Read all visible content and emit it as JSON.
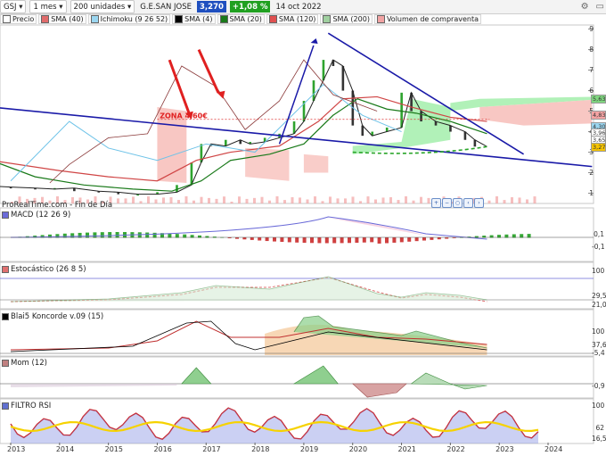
{
  "toolbar": {
    "symbol": "GSJ",
    "period": "1 mes",
    "units": "200 unidades",
    "instrument": "G.E.SAN JOSE",
    "last_price": "3,270",
    "change": "+1,08 %",
    "date": "14 oct 2022"
  },
  "legend": {
    "items": [
      {
        "label": "Precio",
        "color": "#ffffff"
      },
      {
        "label": "SMA (40)",
        "color": "#e06b6b"
      },
      {
        "label": "Ichimoku (9 26 52)",
        "color": "#9bd6f0"
      },
      {
        "label": "SMA (4)",
        "color": "#000000"
      },
      {
        "label": "SMA (20)",
        "color": "#1a7a1a"
      },
      {
        "label": "SMA (120)",
        "color": "#e05050"
      },
      {
        "label": "SMA (200)",
        "color": "#a0d0a0"
      },
      {
        "label": "Volumen de compraventa",
        "color": "#f2a3a3"
      }
    ]
  },
  "main_pane": {
    "source": "ProRealTime.com - Fin de Día",
    "annotation": "ZONA 4,60€",
    "y_ticks": [
      "9",
      "8",
      "7",
      "6",
      "5",
      "4",
      "3",
      "2",
      "1"
    ],
    "value_tags": [
      {
        "text": "5,63",
        "color": "#7fd67f",
        "value": 5.63
      },
      {
        "text": "4,83",
        "color": "#f4a3a3",
        "value": 4.83
      },
      {
        "text": "4,30",
        "color": "#9bd6f0",
        "value": 4.3
      },
      {
        "text": "3,96",
        "color": "#ffffff",
        "value": 3.96
      },
      {
        "text": "3,65",
        "color": "#ffffff",
        "value": 3.65
      },
      {
        "text": "3,27",
        "color": "#f6c400",
        "value": 3.27
      }
    ]
  },
  "panes": {
    "macd": {
      "label": "MACD (12 26 9)",
      "color": "#6a6ad8",
      "y_ticks": [
        "0,1",
        "-0,1"
      ]
    },
    "stoch": {
      "label": "Estocástico (26 8 5)",
      "color": "#e07070",
      "y_ticks": [
        "100",
        "29,5",
        "21,0"
      ]
    },
    "blai5": {
      "label": "Blai5 Koncorde v.09 (15)",
      "color": "#000000",
      "y_ticks": [
        "100",
        "37,6",
        "-5,4"
      ]
    },
    "mom": {
      "label": "Mom (12)",
      "color": "#c08080",
      "y_ticks": [
        "-0,9"
      ]
    },
    "rsi": {
      "label": "FILTRO RSI",
      "color": "#6070d0",
      "y_ticks": [
        "100",
        "62",
        "16,5"
      ]
    }
  },
  "chart_data": {
    "type": "line",
    "title": "G.E.SAN JOSE (GSJ) — 1 mes",
    "x_axis": {
      "ticks": [
        "2013",
        "2014",
        "2015",
        "2016",
        "2017",
        "2018",
        "2019",
        "2020",
        "2021",
        "2022",
        "2023",
        "2024"
      ]
    },
    "y_axis": {
      "min": 0.5,
      "max": 9.2,
      "ticks": [
        1,
        2,
        3,
        4,
        5,
        6,
        7,
        8,
        9
      ]
    },
    "series": [
      {
        "name": "Precio",
        "x": [
          2012.6,
          2013.0,
          2013.5,
          2013.9,
          2014.3,
          2014.8,
          2015.2,
          2015.6,
          2016.0,
          2016.4,
          2016.7,
          2016.9,
          2017.1,
          2017.4,
          2017.7,
          2017.9,
          2018.2,
          2018.5,
          2018.8,
          2019.0,
          2019.2,
          2019.4,
          2019.6,
          2019.8,
          2020.0,
          2020.2,
          2020.4,
          2020.7,
          2021.0,
          2021.2,
          2021.4,
          2021.7,
          2022.0,
          2022.3,
          2022.5,
          2022.75
        ],
        "values": [
          1.35,
          1.3,
          1.25,
          1.2,
          1.25,
          1.1,
          1.05,
          0.95,
          0.95,
          1.05,
          1.4,
          2.5,
          3.4,
          3.3,
          3.6,
          3.4,
          3.5,
          3.7,
          3.9,
          4.5,
          5.5,
          6.5,
          7.5,
          7.2,
          6.0,
          4.3,
          3.8,
          4.0,
          4.2,
          5.9,
          5.0,
          4.5,
          4.3,
          4.0,
          3.6,
          3.27
        ]
      },
      {
        "name": "SMA (40)",
        "x": [
          2012.6,
          2014.0,
          2015.0,
          2016.0,
          2016.8,
          2017.5,
          2018.5,
          2019.3,
          2019.8,
          2020.5,
          2021.2,
          2022.0,
          2022.75
        ],
        "values": [
          2.6,
          2.1,
          1.8,
          1.6,
          2.6,
          3.0,
          3.3,
          4.5,
          5.6,
          5.7,
          5.2,
          4.7,
          4.5
        ]
      },
      {
        "name": "SMA (20)",
        "x": [
          2012.6,
          2013.5,
          2014.5,
          2015.5,
          2016.3,
          2016.9,
          2017.5,
          2018.3,
          2019.0,
          2019.6,
          2020.1,
          2020.7,
          2021.3,
          2022.0,
          2022.75
        ],
        "values": [
          2.6,
          1.8,
          1.4,
          1.2,
          1.1,
          1.6,
          2.6,
          2.9,
          3.4,
          4.8,
          5.6,
          5.1,
          4.9,
          4.5,
          3.9
        ]
      }
    ],
    "trendlines": [
      {
        "name": "Directriz bajista",
        "from": [
          2012.6,
          5.2
        ],
        "to": [
          2024.9,
          2.3
        ],
        "color": "#1a1aa8"
      },
      {
        "name": "Techo bajista",
        "from": [
          2019.5,
          8.8
        ],
        "to": [
          2023.5,
          2.9
        ],
        "color": "#1a1aa8"
      }
    ],
    "annotations": [
      {
        "text": "ZONA 4,60€",
        "x": 2016.2,
        "y": 4.6
      }
    ]
  }
}
